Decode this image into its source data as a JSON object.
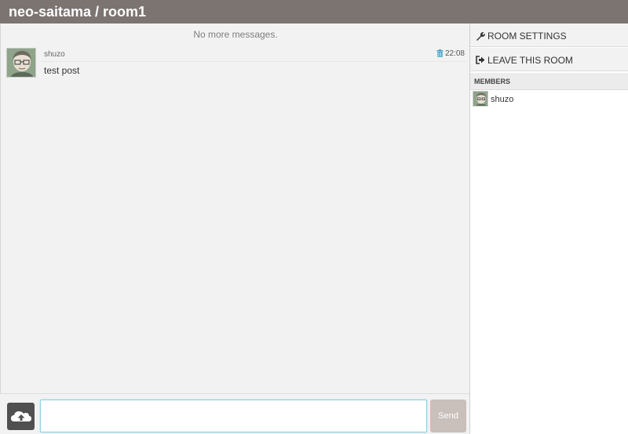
{
  "header": {
    "title": "neo-saitama / room1"
  },
  "messages": {
    "no_more": "No more messages.",
    "items": [
      {
        "author": "shuzo",
        "time": "22:08",
        "text": "test post"
      }
    ]
  },
  "composer": {
    "value": "",
    "send_label": "Send"
  },
  "sidebar": {
    "room_settings": "ROOM SETTINGS",
    "leave_room": "LEAVE THIS ROOM",
    "members_heading": "MEMBERS",
    "members": [
      {
        "name": "shuzo"
      }
    ]
  },
  "colors": {
    "header_bg": "#7b7471",
    "send_bg": "#c9bfbb",
    "upload_bg": "#505050",
    "input_border": "#8fd0e0",
    "trash_icon": "#47a8c8"
  }
}
